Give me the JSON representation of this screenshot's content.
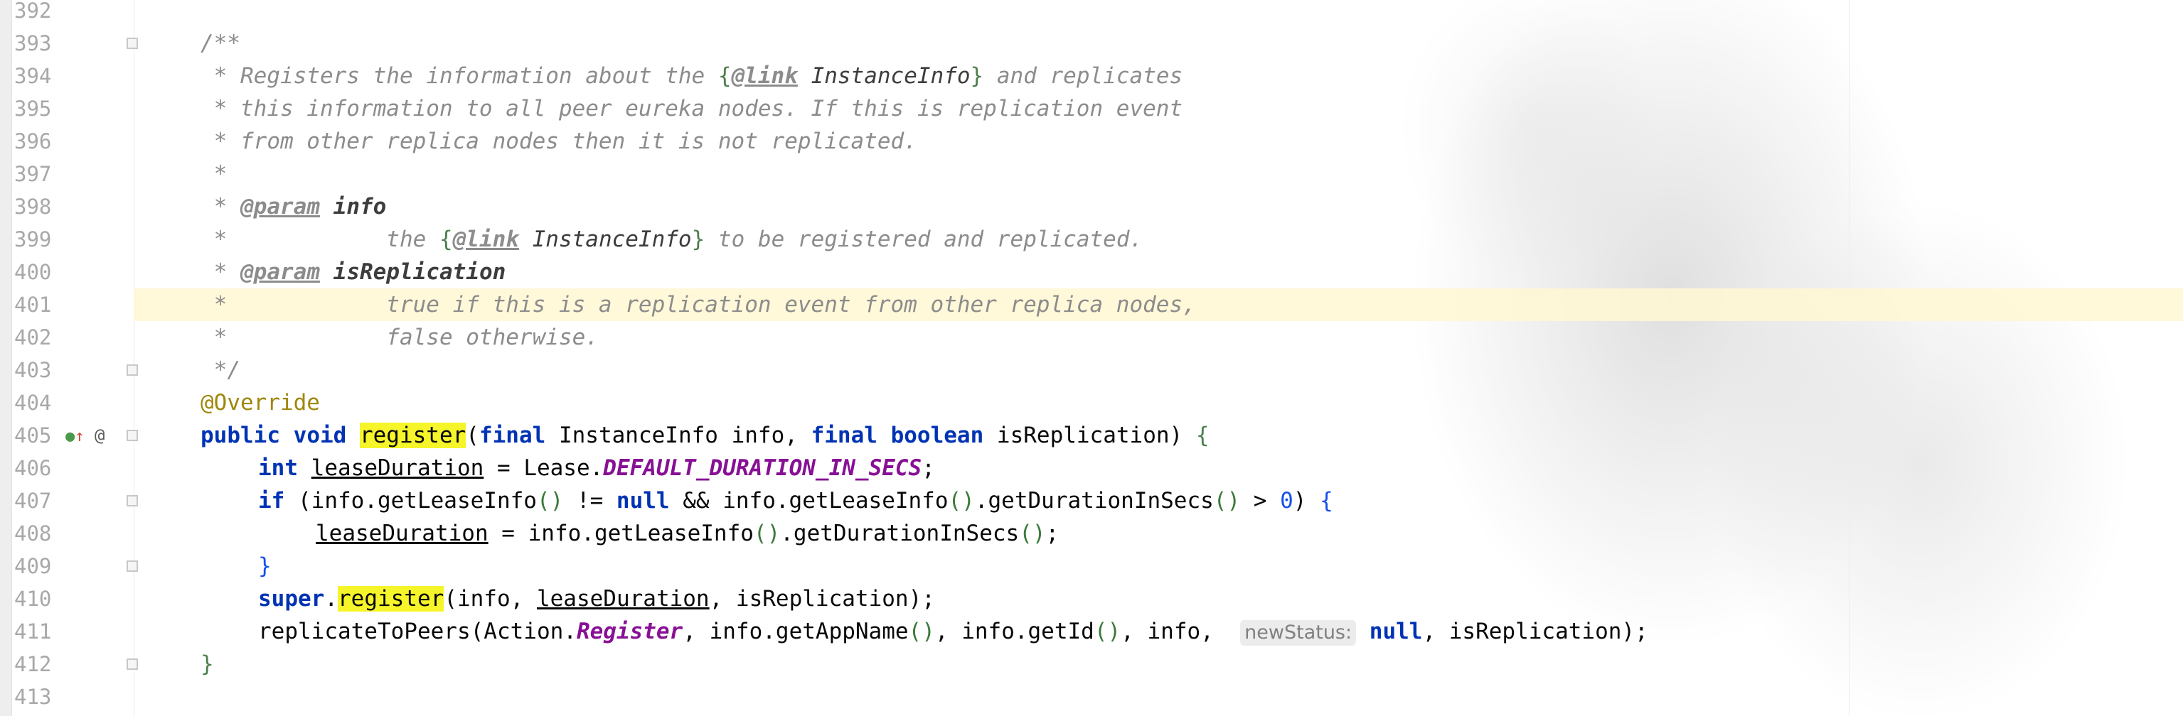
{
  "editor": {
    "caret_line": "401",
    "inline_hint": "newStatus:",
    "gutter_icons": {
      "override_icon": "green-circle-override-icon",
      "up_arrow_icon": "red-up-arrow-icon",
      "annotation_icon": "@"
    },
    "tokens": {
      "doc_open": "/**",
      "doc_star": " *",
      "doc_star_close": " */",
      "d394a": " * Registers the information about the ",
      "d394b": "{",
      "link_tag": "@link",
      "instanceinfo_ref": "InstanceInfo",
      "d394c": "}",
      "d394d": " and replicates",
      "d395": " * this information to all peer eureka nodes. If this is replication event",
      "d396": " * from other replica nodes then it is not replicated.",
      "param_tag": "@param",
      "info_param": "info",
      "d399a": "            the ",
      "d399b": " to be registered and replicated.",
      "isreplication_param": "isReplication",
      "d401": "            true if this is a replication event from other replica nodes,",
      "d402": "            false otherwise.",
      "override": "@Override",
      "public": "public",
      "void": "void",
      "register": "register",
      "final": "final",
      "instanceinfo_type": "InstanceInfo",
      "boolean": "boolean",
      "int": "int",
      "if": "if",
      "null": "null",
      "super": "super",
      "leaseDuration": "leaseDuration",
      "lease_class": "Lease.",
      "default_duration": "DEFAULT_DURATION_IN_SECS",
      "zero": "0",
      "action_class": "Action.",
      "register_const": "Register",
      "replicate": "replicateToPeers"
    },
    "lines": [
      "392",
      "393",
      "394",
      "395",
      "396",
      "397",
      "398",
      "399",
      "400",
      "401",
      "402",
      "403",
      "404",
      "405",
      "406",
      "407",
      "408",
      "409",
      "410",
      "411",
      "412",
      "413"
    ]
  }
}
